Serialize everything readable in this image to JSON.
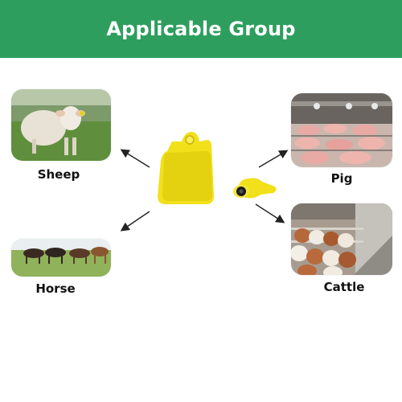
{
  "banner": {
    "title": "Applicable Group"
  },
  "animals": {
    "sheep": "Sheep",
    "pig": "Pig",
    "horse": "Horse",
    "cattle": "Cattle"
  },
  "colors": {
    "banner": "#2e9e5e",
    "tag_yellow": "#f1e01a",
    "arrow": "#222222"
  },
  "icons": {
    "center": "yellow-ear-tag-icon",
    "arrows": "arrow-icon"
  }
}
